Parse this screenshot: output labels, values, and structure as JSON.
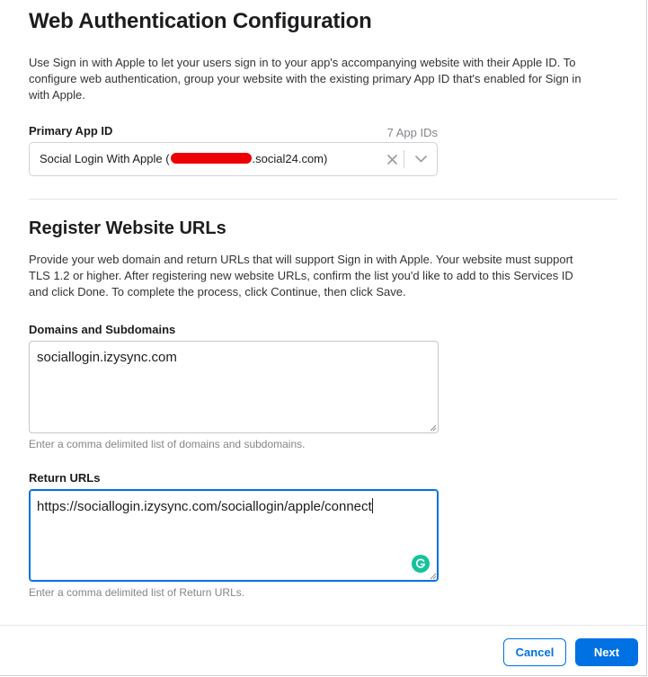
{
  "header": {
    "title": "Web Authentication Configuration",
    "description": "Use Sign in with Apple to let your users sign in to your app's accompanying website with their Apple ID. To configure web authentication, group your website with the existing primary App ID that's enabled for Sign in with Apple."
  },
  "primary_app_id": {
    "label": "Primary App ID",
    "count": "7 App IDs",
    "value_prefix": "Social Login With Apple (",
    "value_suffix": ".social24.com)",
    "clear_icon": "close-icon",
    "dropdown_icon": "chevron-down-icon"
  },
  "register": {
    "title": "Register Website URLs",
    "description": "Provide your web domain and return URLs that will support Sign in with Apple. Your website must support TLS 1.2 or higher. After registering new website URLs, confirm the list you'd like to add to this Services ID and click Done. To complete the process, click Continue, then click Save."
  },
  "domains": {
    "label": "Domains and Subdomains",
    "value": "sociallogin.izysync.com",
    "hint": "Enter a comma delimited list of domains and subdomains."
  },
  "return_urls": {
    "label": "Return URLs",
    "value": "https://sociallogin.izysync.com/sociallogin/apple/connect",
    "hint": "Enter a comma delimited list of Return URLs.",
    "grammarly_icon": "grammarly-icon"
  },
  "footer": {
    "cancel_label": "Cancel",
    "next_label": "Next"
  },
  "colors": {
    "accent": "#0071e3",
    "redaction": "#ee0000",
    "grammarly": "#15c39a"
  }
}
